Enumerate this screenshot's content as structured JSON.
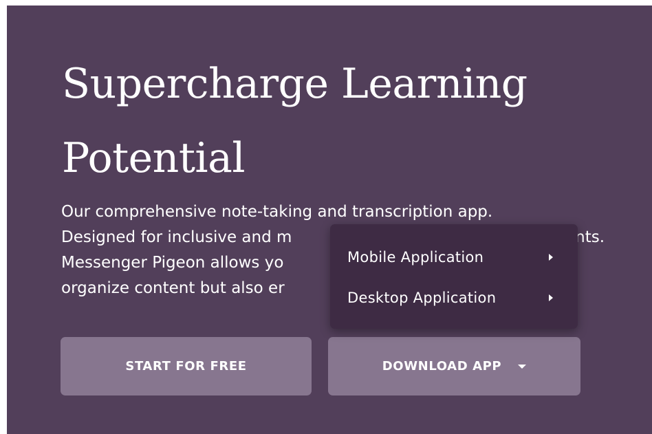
{
  "hero": {
    "headline_lines": [
      "Supercharge Learning",
      "Potential"
    ],
    "body_lines": [
      "Our comprehensive note-taking and transcription app.",
      "Designed for inclusive and m",
      "Messenger Pigeon allows yo",
      "organize content but also er"
    ],
    "body_line2_tail": "ents."
  },
  "buttons": {
    "start_label": "START FOR FREE",
    "download_label": "DOWNLOAD APP"
  },
  "dropdown": {
    "items": [
      {
        "label": "Mobile Application",
        "icon": "chevron-right-icon"
      },
      {
        "label": "Desktop Application",
        "icon": "chevron-right-icon"
      }
    ]
  },
  "colors": {
    "background": "#523f5a",
    "button": "#87768f",
    "dropdown": "#3e2b44",
    "text": "#ffffff"
  }
}
